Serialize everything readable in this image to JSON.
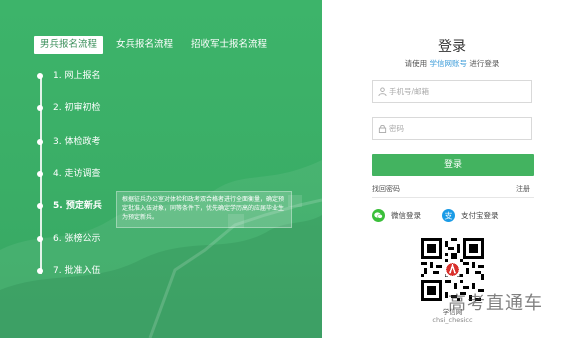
{
  "tabs": [
    {
      "label": "男兵报名流程",
      "active": true
    },
    {
      "label": "女兵报名流程",
      "active": false
    },
    {
      "label": "招收军士报名流程",
      "active": false
    }
  ],
  "steps": [
    {
      "label": "1. 网上报名"
    },
    {
      "label": "2. 初审初检"
    },
    {
      "label": "3. 体检政考"
    },
    {
      "label": "4. 走访调查"
    },
    {
      "label": "5. 预定新兵",
      "active": true
    },
    {
      "label": "6. 张榜公示"
    },
    {
      "label": "7. 批准入伍"
    }
  ],
  "tooltip": {
    "text": "根据征兵办公室对体检和政考双合格者进行全面衡量，确定预定批准入伍对象，同等条件下，优先确定学历高的应届毕业生为预定新兵。"
  },
  "login": {
    "title": "登录",
    "subtitle_prefix": "请使用",
    "subtitle_link": "学信网账号",
    "subtitle_suffix": "进行登录",
    "username_placeholder": "手机号/邮箱",
    "password_placeholder": "密码",
    "button_label": "登录",
    "forgot_label": "找回密码",
    "register_label": "注册",
    "wechat_label": "微信登录",
    "alipay_label": "支付宝登录"
  },
  "qr": {
    "caption": "学信网",
    "handle": "chsi_chesicc"
  },
  "watermark": "高考直通车",
  "colors": {
    "green": "#3db46a",
    "button_green": "#43b360",
    "link_blue": "#3a9bd9",
    "wechat": "#3bbf3b",
    "alipay": "#1a9be6"
  }
}
